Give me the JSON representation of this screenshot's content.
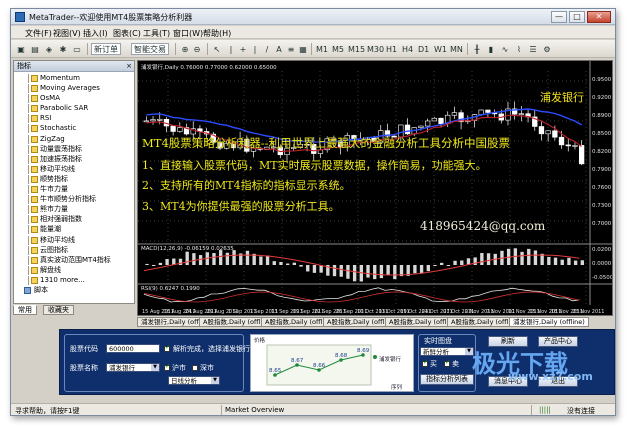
{
  "window": {
    "title": "MetaTrader--欢迎使用MT4股票策略分析利器",
    "controls": {
      "minimize": "—",
      "maximize": "□",
      "close": "✕"
    }
  },
  "menubar": [
    "文件(F)",
    "视图(V)",
    "插入(I)",
    "图表(C)",
    "工具(T)",
    "窗口(W)",
    "帮助(H)"
  ],
  "toolbar": {
    "new_order": "新订单",
    "auto_trade": "智能交易",
    "tools": [
      "|",
      "+",
      "|",
      "/",
      "A",
      "≡",
      "▦"
    ],
    "periods": [
      "M1",
      "M5",
      "M15",
      "M30",
      "H1",
      "H4",
      "D1",
      "W1",
      "MN"
    ]
  },
  "navigator": {
    "title": "指标",
    "items": [
      "Momentum",
      "Moving Averages",
      "OsMA",
      "Parabolic SAR",
      "RSI",
      "Stochastic",
      "ZigZag",
      "动量震荡指标",
      "加速振荡指标",
      "移动平均线",
      "顺势指标",
      "牛市力量",
      "牛市顺势分析指标",
      "熊市力量",
      "相对强弱指数",
      "能量潮",
      "移动平均线",
      "云图指标",
      "真实波动范围MT4指标",
      "解盘线",
      "1310 more..."
    ],
    "scripts_label": "脚本",
    "tabs": [
      "常用",
      "收藏夹"
    ]
  },
  "chart": {
    "header": "浦发银行,Daily  0.76000 0.77000 0.62000 0.65000",
    "bank_name": "浦发银行",
    "overlay_lines": [
      "MT4股票策略分析利器--利用世界上最强大的金融分析工具分析中国股票",
      "1、直接输入股票代码，MT实时展示股票数据，操作简易，功能强大。",
      "2、支持所有的MT4指标的指标显示系统。",
      "3、MT4为你提供最强的股票分析工具。"
    ],
    "contact": "418965424@qq.com",
    "macd_label": "MACD(12,26,9) -0.06159 0.02635",
    "rsi_label": "RSI(9) 0.6247 0.1990",
    "price_axis": [
      "0.9500",
      "0.9200",
      "0.8900",
      "0.8500",
      "0.8200",
      "0.7900",
      "0.7600",
      "0.7300",
      "0.7000"
    ],
    "macd_axis": [
      "0.0200",
      "0.0000",
      "-0.0500"
    ],
    "date_axis": [
      "15 Aug 2011",
      "18 Aug 2011",
      "24 Aug 2011",
      "29 Aug 2011",
      "1 Sep 2011",
      "7 Sep 2011",
      "13 Sep 2011",
      "19 Sep 2011",
      "22 Sep 2011",
      "28 Sep 2011",
      "10 Oct 2011",
      "13 Oct 2011",
      "19 Oct 2011",
      "24 Oct 2011",
      "27 Oct 2011",
      "2 Nov 2011",
      "7 Nov 2011",
      "10 Nov 2011",
      "15 Nov 2011",
      "18 Nov 2011",
      "23 Nov 2011"
    ],
    "colors": {
      "up": "#ffffff",
      "down": "#ffffff",
      "ma_blue": "#2c4cff",
      "ma_red": "#c0202a",
      "text": "#f0ea1a"
    }
  },
  "chart_tabs": [
    "浦发银行,Daily (offline)",
    "A股指数,Daily (offline)",
    "A股指数,Daily (offline)",
    "A股指数,Daily (offline)",
    "A股指数,Daily (offline)",
    "A股指数,Daily (offline)",
    "浦发银行,Daily (offline)"
  ],
  "panel": {
    "code_label": "股票代码",
    "code_value": "600000",
    "name_label": "股票名称",
    "name_value": "浦发银行",
    "parse_msg": "解析完成，选择浦发银行",
    "market_sh": "沪市",
    "market_sz": "深市",
    "period_value": "日线分析",
    "mini_chart": {
      "title": "价格",
      "legend": "浦发银行",
      "values": [
        "8.65",
        "8.67",
        "8.66",
        "8.68",
        "8.69"
      ],
      "x_title": "序列"
    },
    "realtime_title": "实时图盘",
    "realtime_value": "新鲜分析",
    "buy_label": "买",
    "sell_label": "卖",
    "analyze_btn": "指标分析列表",
    "btn_refresh": "刷新",
    "btn_produce": "产品中心",
    "btn_message": "消息中心",
    "btn_exit": "退出"
  },
  "statusbar": {
    "help": "寻求帮助，请按F1键",
    "overview": "Market Overview",
    "connection": "没有连接",
    "bars": "|||||"
  },
  "watermark": {
    "brand": "极光下载",
    "site": "www.xz7.com"
  }
}
